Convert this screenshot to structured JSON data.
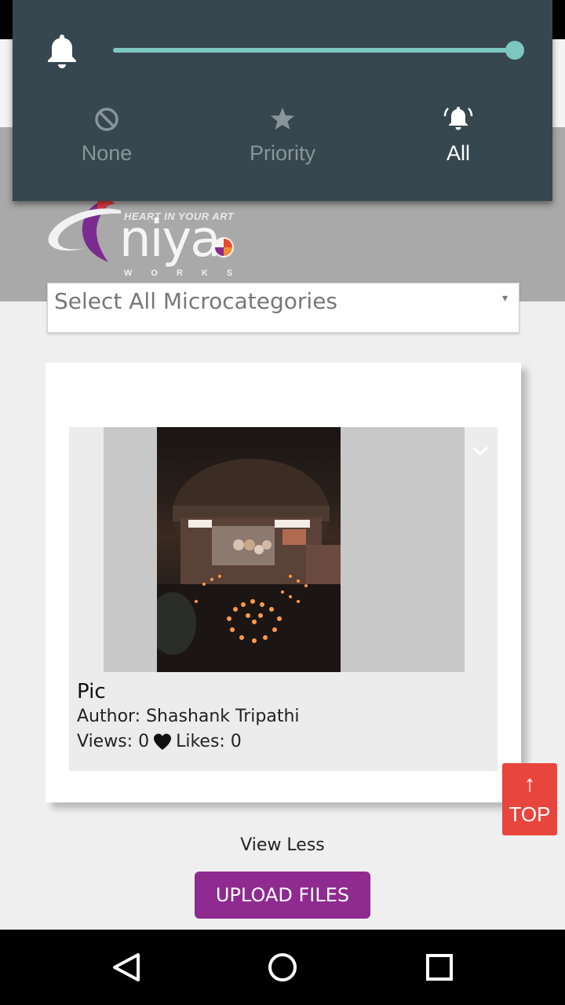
{
  "notification_panel": {
    "modes": [
      {
        "label": "None",
        "icon": "block-icon"
      },
      {
        "label": "Priority",
        "icon": "star-icon"
      },
      {
        "label": "All",
        "icon": "bell-ringing-icon"
      }
    ],
    "active_mode": "All",
    "volume_level": 1.0,
    "accent_color": "#7cc8c0"
  },
  "brand": {
    "tagline": "HEART IN YOUR ART",
    "wordmark": "niya",
    "subtitle": "WORKS"
  },
  "filter": {
    "microcategory_placeholder": "Select All Microcategories"
  },
  "gallery": {
    "items": [
      {
        "title": "Pic",
        "author": "Author: Shashank Tripathi",
        "views": "Views: 0",
        "likes": "Likes: 0"
      }
    ]
  },
  "actions": {
    "top_arrow": "↑",
    "top_label": "TOP",
    "view_less": "View Less",
    "upload": "UPLOAD FILES",
    "upload_color": "#8e2a90",
    "top_color": "#e8453c"
  }
}
